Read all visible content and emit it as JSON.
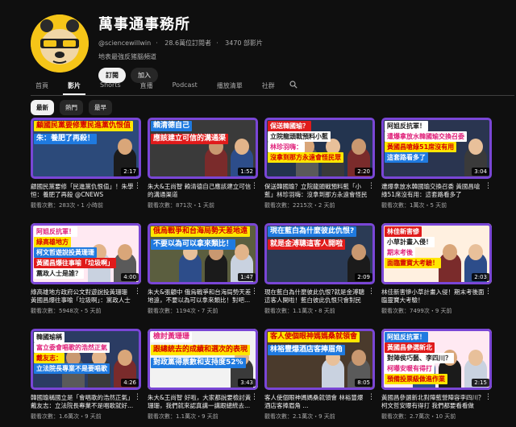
{
  "channel": {
    "name": "萬事通事務所",
    "handle": "@sciencewillwin",
    "subscribers": "28.6萬位訂閱者",
    "video_count": "3470 部影片",
    "description": "地表最強反猪腦頻道",
    "subscribe_label": "訂閱",
    "join_label": "加入"
  },
  "tabs": [
    {
      "label": "首頁",
      "active": false
    },
    {
      "label": "影片",
      "active": true
    },
    {
      "label": "Shorts",
      "active": false
    },
    {
      "label": "直播",
      "active": false
    },
    {
      "label": "Podcast",
      "active": false
    },
    {
      "label": "播放清單",
      "active": false
    },
    {
      "label": "社群",
      "active": false
    }
  ],
  "filters": [
    {
      "label": "最新",
      "active": true
    },
    {
      "label": "熱門",
      "active": false
    },
    {
      "label": "最早",
      "active": false
    }
  ],
  "videos": [
    {
      "title": "顧國民黨要修「民進黨仇恨值」！朱學恒：養肥了再殺 @CNEWS",
      "stats": "觀看次數：283次・1 小時前",
      "duration": "2:17",
      "caption1": "顧國民黨要修憲民進黨仇恨值",
      "caption2": "朱：養肥了再殺！",
      "bg": "#2c4a7a"
    },
    {
      "title": "朱大&王尚智 賴清德自己應該建立可信的溝通渠道",
      "stats": "觀看次數：871次・1 天前",
      "duration": "1:52",
      "caption1": "賴清德自己",
      "caption2": "應該建立可信的溝通渠",
      "bg": "#3a3a3a"
    },
    {
      "title": "保送韓國瑜？立院龍頭戰預料藍「小藍」林珍羽嗨：沒拿到那方永遠會怪民眾...",
      "stats": "觀看次數：2215次・2 天前",
      "duration": "2:20",
      "caption1": "保送韓國瑜？",
      "caption2": "立院龍頭戰預料小藍",
      "caption3": "林珍羽嗨：",
      "caption4": "沒拿到那方永遠會怪民眾",
      "bg": "#23344f"
    },
    {
      "title": "遭爆拿放水韓國瑜交換召委 黃國昌嗆綠51席沒有用：這套路看多了 @CNEWS",
      "stats": "觀看次數：1萬次・5 天前",
      "duration": "3:04",
      "caption1": "阿姐反抗軍！",
      "caption2": "遭爆拿放水韓國瑜交換召委",
      "caption3": "黃國昌嗆綠51席沒有用",
      "caption4": "這套路看多了",
      "bg": "#2a3550"
    },
    {
      "title": "綠高雄地方政府公文對遊說投黃珊珊 黃國昌爆往事喻「垃圾啊」：黨政人士是誰...",
      "stats": "觀看次數：5948次・5 天前",
      "duration": "4:00",
      "caption1": "阿姐反抗軍！",
      "caption2": "綠高雄地方",
      "caption3": "柯文哲遊說投黃珊珊",
      "caption4": "黃國昌爆往事喻「垃圾啊」",
      "caption5": "黨政人士是誰？",
      "bg": "#ffe9f2"
    },
    {
      "title": "朱大&張顧中 俄烏戰爭和台海局勢天差地遠，不要以為可以拿來類比！對吧...",
      "stats": "觀看次數：1194次・7 天前",
      "duration": "1:47",
      "caption1": "俄烏戰爭和台海局勢天差地遠",
      "caption2": "不要以為可以拿來類比！",
      "bg": "#5b5e3f"
    },
    {
      "title": "現在藍白為什麼彼此仇恨?就是金溥聰這客人開啦！藍白彼此仇恨只會對民進...",
      "stats": "觀看次數：1.1萬次・8 天前",
      "duration": "2:09",
      "caption1": "現在藍白為什麼彼此仇恨?",
      "caption2": "就是金溥聰這客人開啦",
      "bg": "#2b3b55"
    },
    {
      "title": "林佳新害慘小草計畫入侵！期末考後面臨靈寶大考驗！",
      "stats": "觀看次數：7499次・9 天前",
      "duration": "2:03",
      "caption1": "林佳新害慘",
      "caption2": "小草計畫入侵！",
      "caption3": "期末考後",
      "caption4": "面臨靈寶大考驗！",
      "bg": "#fff0e0"
    },
    {
      "title": "韓國瑜稱國立是「會唱歌的浩然正氣」 戴友志：立法院長專業不是唱歌就好...",
      "stats": "觀看次數：1.6萬次・9 天前",
      "duration": "4:26",
      "caption1": "韓國瑜稱",
      "caption2": "富立委會唱歌的浩然正氣",
      "caption3": "戴友志：",
      "caption4": "立法院長專業不是要唱歌",
      "bg": "#2b3c63"
    },
    {
      "title": "朱大&王尚智 好啦，大家都說要檢討黃珊珊，我們就來認真講一講跟總統去...",
      "stats": "觀看次數：1.1萬次・9 天前",
      "duration": "3:43",
      "caption1": "檢討黃珊珊",
      "caption2": "跟總統去的成績和選次的表現",
      "caption3": "對政黨得票數和支持度52%",
      "bg": "#f2f2f2"
    },
    {
      "title": "客人使個眼神媽媽桑就領會 林裕豐爆酒店客捧眉角 ...",
      "stats": "觀看次數：2.1萬次・9 天前",
      "duration": "8:05",
      "caption1": "客人使個眼神媽媽桑就領會",
      "caption2": "林裕豐爆酒店客捧眉角",
      "bg": "#4a3a2c"
    },
    {
      "title": "黃國昌參選新北對陣藍營陣容李四川？柯文哲安曝有得打 我們都要看看做個...",
      "stats": "觀看次數：2.7萬次・10 天前",
      "duration": "2:15",
      "caption1": "阿姐反抗軍！",
      "caption2": "黃國昌參選新北",
      "caption3": "對陣侯巧藝、李四川？",
      "caption4": "柯曝安暖有得打",
      "caption5": "預備投票級做進作業",
      "bg": "#ffe9f2"
    }
  ]
}
